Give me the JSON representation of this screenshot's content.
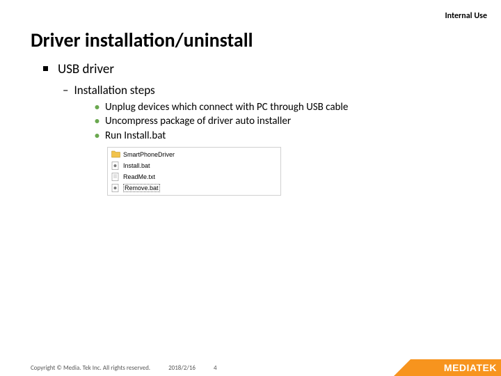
{
  "header": {
    "classification": "Internal Use"
  },
  "title": "Driver installation/uninstall",
  "body": {
    "lvl1": "USB driver",
    "lvl2": "Installation steps",
    "steps": [
      "Unplug devices which connect with PC through USB cable",
      "Uncompress package of driver auto installer",
      "Run Install.bat"
    ]
  },
  "files": [
    {
      "name": "SmartPhoneDriver",
      "type": "folder"
    },
    {
      "name": "Install.bat",
      "type": "bat"
    },
    {
      "name": "ReadMe.txt",
      "type": "txt"
    },
    {
      "name": "Remove.bat",
      "type": "bat",
      "selected": true
    }
  ],
  "footer": {
    "copyright": "Copyright © Media. Tek Inc. All rights reserved.",
    "date": "2018/2/16",
    "page": "4",
    "brand_prefix": "MEDIA",
    "brand_suffix": "TEK"
  }
}
